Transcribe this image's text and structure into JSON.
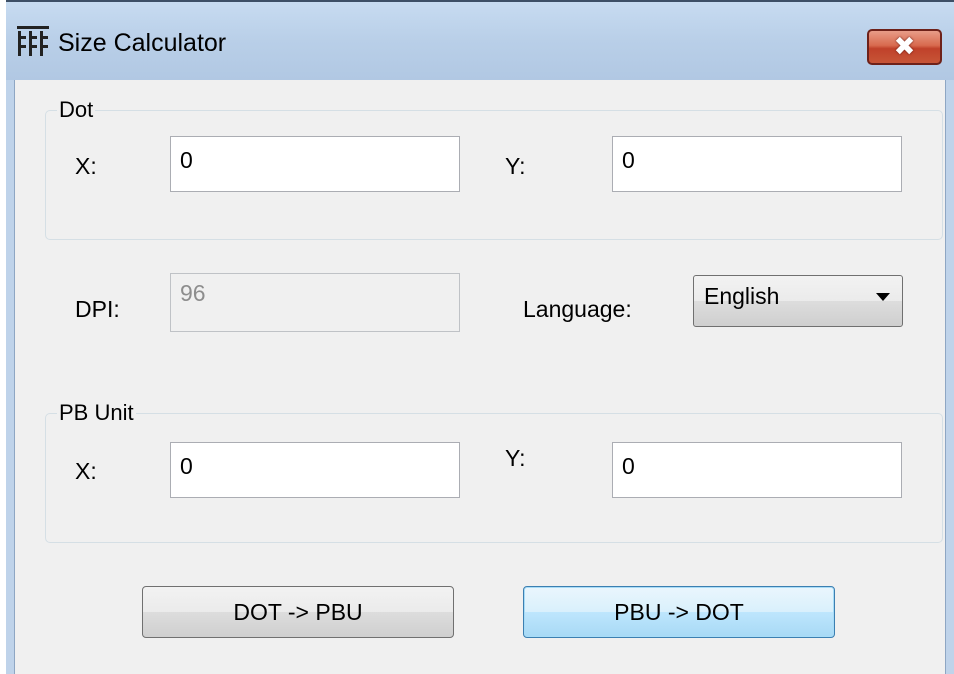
{
  "window": {
    "title": "Size Calculator",
    "close_label": "✖"
  },
  "dot_group": {
    "label": "Dot",
    "x_label": "X:",
    "x_value": "0",
    "y_label": "Y:",
    "y_value": "0"
  },
  "dpi": {
    "label": "DPI:",
    "value": "96"
  },
  "language": {
    "label": "Language:",
    "selected": "English"
  },
  "pbu_group": {
    "label": "PB Unit",
    "x_label": "X:",
    "x_value": "0",
    "y_label": "Y:",
    "y_value": "0"
  },
  "buttons": {
    "dot_to_pbu": "DOT -> PBU",
    "pbu_to_dot": "PBU -> DOT"
  },
  "colors": {
    "title_bar": "#b9cfe8",
    "close_button": "#c7472f",
    "dialog_background": "#f0f0f0",
    "default_button": "#bee6fd"
  },
  "icons": {
    "app": "grid-app-icon",
    "close": "close-icon",
    "dropdown": "chevron-down-icon"
  }
}
